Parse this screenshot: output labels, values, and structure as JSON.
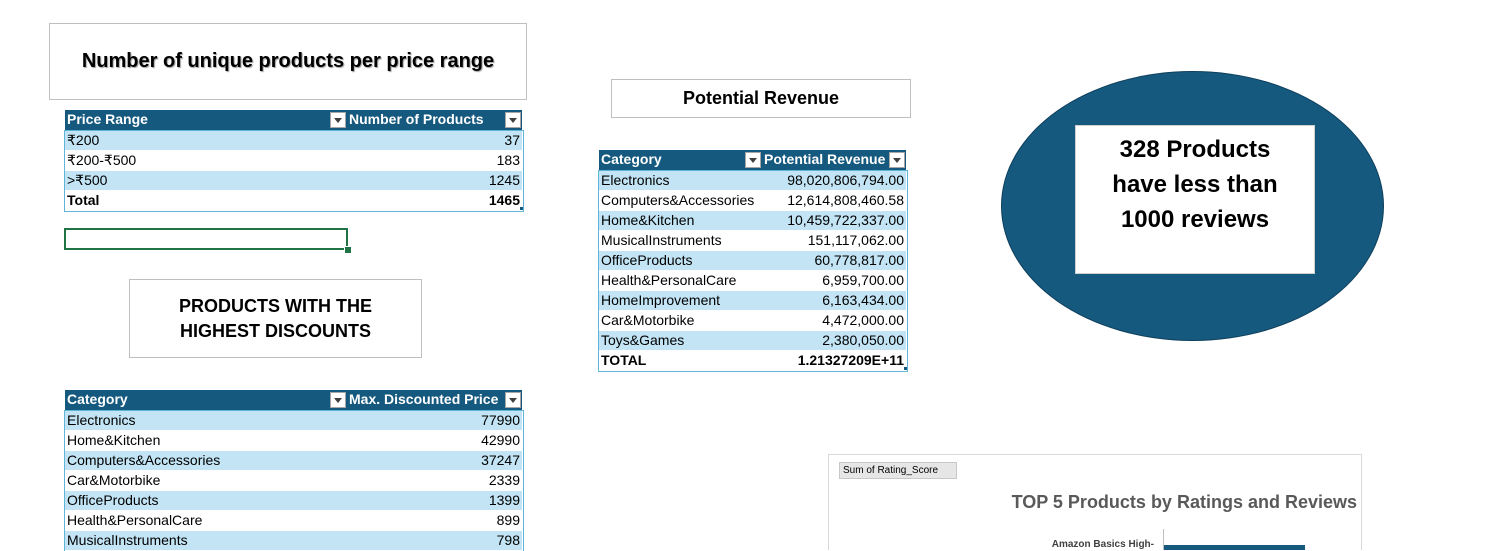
{
  "price_range_title": "Number of unique products per price range",
  "price_table": {
    "headers": [
      "Price Range",
      "Number of Products"
    ],
    "rows": [
      [
        "₹200",
        "37"
      ],
      [
        "₹200-₹500",
        "183"
      ],
      [
        ">₹500",
        "1245"
      ]
    ],
    "total": [
      "Total",
      "1465"
    ]
  },
  "discount_title": "PRODUCTS WITH THE HIGHEST DISCOUNTS",
  "discount_table": {
    "headers": [
      "Category",
      "Max. Discounted Price"
    ],
    "rows": [
      [
        "Electronics",
        "77990"
      ],
      [
        "Home&Kitchen",
        "42990"
      ],
      [
        "Computers&Accessories",
        "37247"
      ],
      [
        "Car&Motorbike",
        "2339"
      ],
      [
        "OfficeProducts",
        "1399"
      ],
      [
        "Health&PersonalCare",
        "899"
      ],
      [
        "MusicalInstruments",
        "798"
      ]
    ]
  },
  "revenue_title": "Potential Revenue",
  "revenue_table": {
    "headers": [
      "Category",
      "Potential Revenue"
    ],
    "rows": [
      [
        "Electronics",
        "98,020,806,794.00"
      ],
      [
        "Computers&Accessories",
        "12,614,808,460.58"
      ],
      [
        "Home&Kitchen",
        "10,459,722,337.00"
      ],
      [
        "MusicalInstruments",
        "151,117,062.00"
      ],
      [
        "OfficeProducts",
        "60,778,817.00"
      ],
      [
        "Health&PersonalCare",
        "6,959,700.00"
      ],
      [
        "HomeImprovement",
        "6,163,434.00"
      ],
      [
        "Car&Motorbike",
        "4,472,000.00"
      ],
      [
        "Toys&Games",
        "2,380,050.00"
      ]
    ],
    "total": [
      "TOTAL",
      "1.21327209E+11"
    ]
  },
  "reviews_callout": "328 Products have less than 1000 reviews",
  "chart": {
    "field_button": "Sum of Rating_Score",
    "title": "TOP 5 Products by Ratings and Reviews",
    "first_label": "Amazon Basics High-"
  },
  "colors": {
    "header_blue": "#16597f",
    "band_blue": "#c2e4f4",
    "ellipse_fill": "#16597f"
  }
}
